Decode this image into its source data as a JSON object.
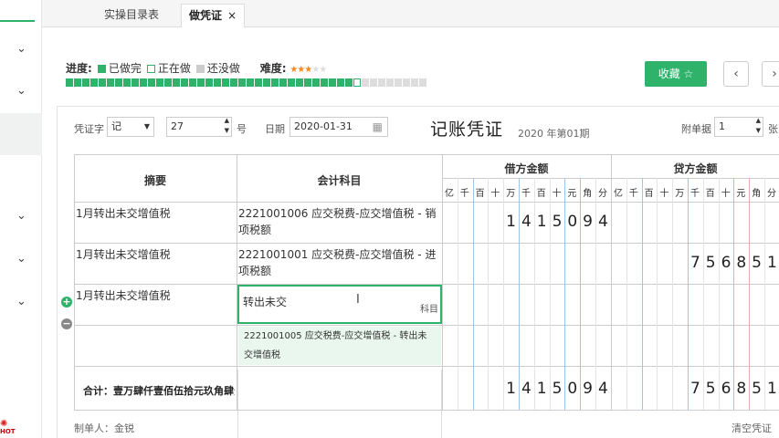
{
  "tabs": [
    {
      "label": "实操目录表"
    },
    {
      "label": "做凭证",
      "close": "×"
    }
  ],
  "progress": {
    "label": "进度:",
    "done": "已做完",
    "doing": "正在做",
    "todo": "还没做",
    "difficulty_label": "难度:",
    "difficulty_stars": 3,
    "difficulty_max": 5,
    "done_count": 35,
    "current_index": 36,
    "total": 44
  },
  "buttons": {
    "collect": "收藏 ☆",
    "prev": "‹",
    "next": "›"
  },
  "voucher": {
    "word_label": "凭证字",
    "word_value": "记",
    "number_value": "27",
    "number_unit": "号",
    "date_label": "日期",
    "date_value": "2020-01-31",
    "title": "记账凭证",
    "period": "2020 年第01期",
    "attach_label": "附单据",
    "attach_value": "1",
    "attach_unit": "张"
  },
  "table": {
    "headers": {
      "summary": "摘要",
      "account": "会计科目",
      "debit": "借方金额",
      "credit": "贷方金额"
    },
    "units": [
      "亿",
      "千",
      "百",
      "十",
      "万",
      "千",
      "百",
      "十",
      "元",
      "角",
      "分"
    ],
    "rows": [
      {
        "summary": "1月转出未交增值税",
        "account": "2221001006 应交税费-应交增值税 - 销项税额",
        "debit": "1415094",
        "credit": ""
      },
      {
        "summary": "1月转出未交增值税",
        "account": "2221001001 应交税费-应交增值税 - 进项税额",
        "debit": "",
        "credit": "756851"
      },
      {
        "summary": "1月转出未交增值税",
        "account_input": "转出未交",
        "account_hint": "科目"
      }
    ],
    "dropdown_option": "2221001005 应交税费-应交增值税 - 转出未交增值税",
    "total_label": "合计：壹万肆仟壹佰伍拾元玖角肆分",
    "total_debit": "1415094",
    "total_credit": "756851"
  },
  "footer": {
    "maker": "制单人：金锐",
    "clear": "清空凭证"
  },
  "sidebar": {
    "logo": "HOT"
  }
}
